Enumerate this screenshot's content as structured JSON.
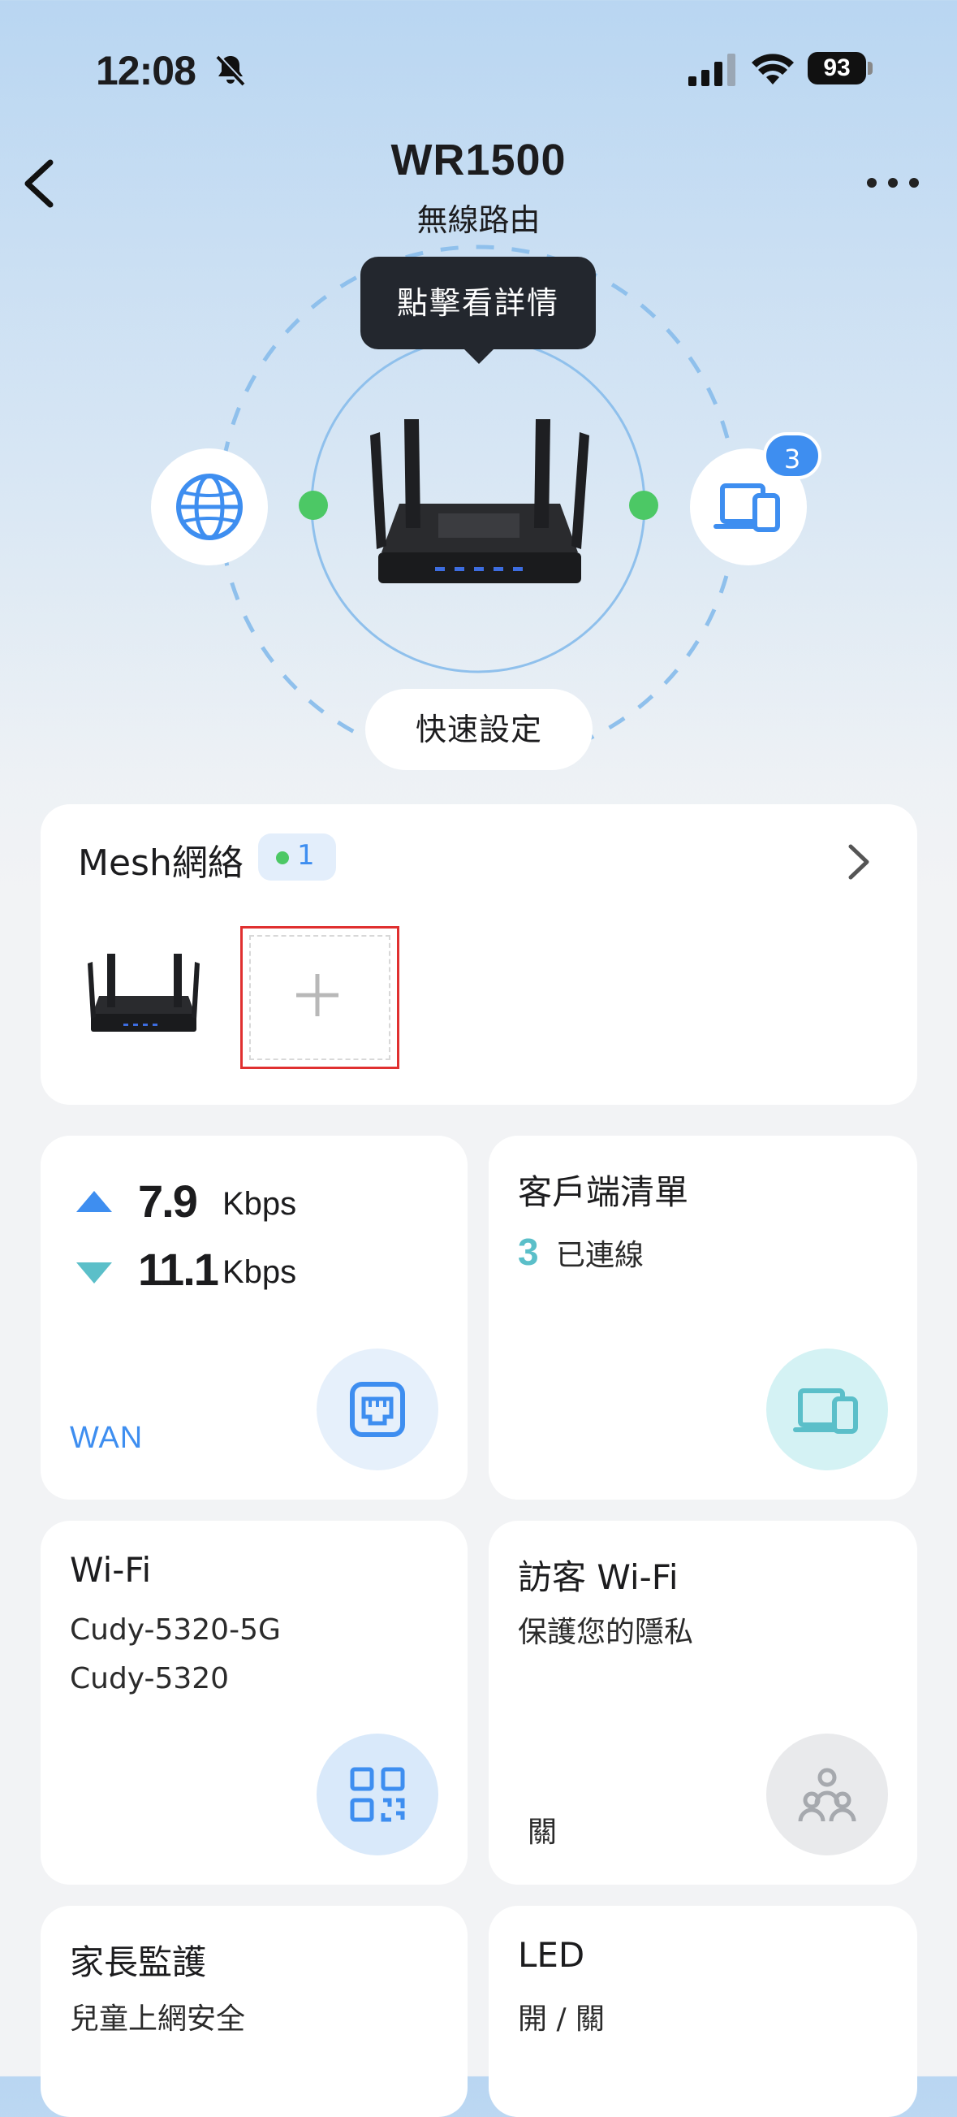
{
  "status_bar": {
    "time": "12:08",
    "battery": "93"
  },
  "header": {
    "title": "WR1500",
    "subtitle": "無線路由"
  },
  "hero": {
    "tooltip": "點擊看詳情",
    "device_count": "3",
    "quick_setup_label": "快速設定"
  },
  "mesh": {
    "title": "Mesh網絡",
    "node_count": "1"
  },
  "wan": {
    "upload_value": "7.9",
    "upload_unit": "Kbps",
    "download_value": "11.1",
    "download_unit": "Kbps",
    "label": "WAN"
  },
  "clients": {
    "title": "客戶端清單",
    "count": "3",
    "status": "已連線"
  },
  "wifi": {
    "title": "Wi-Fi",
    "ssid_5g": "Cudy-5320-5G",
    "ssid_24g": "Cudy-5320"
  },
  "guest_wifi": {
    "title": "訪客 Wi-Fi",
    "subtitle": "保護您的隱私",
    "state": "關"
  },
  "parental": {
    "title": "家長監護",
    "subtitle": "兒童上網安全"
  },
  "led": {
    "title": "LED",
    "subtitle": "開 / 關"
  },
  "colors": {
    "accent": "#3e8ef0",
    "teal": "#5bbfc9",
    "online": "#4cc865",
    "tooltip_bg": "#23272e",
    "highlight": "#e03030"
  }
}
